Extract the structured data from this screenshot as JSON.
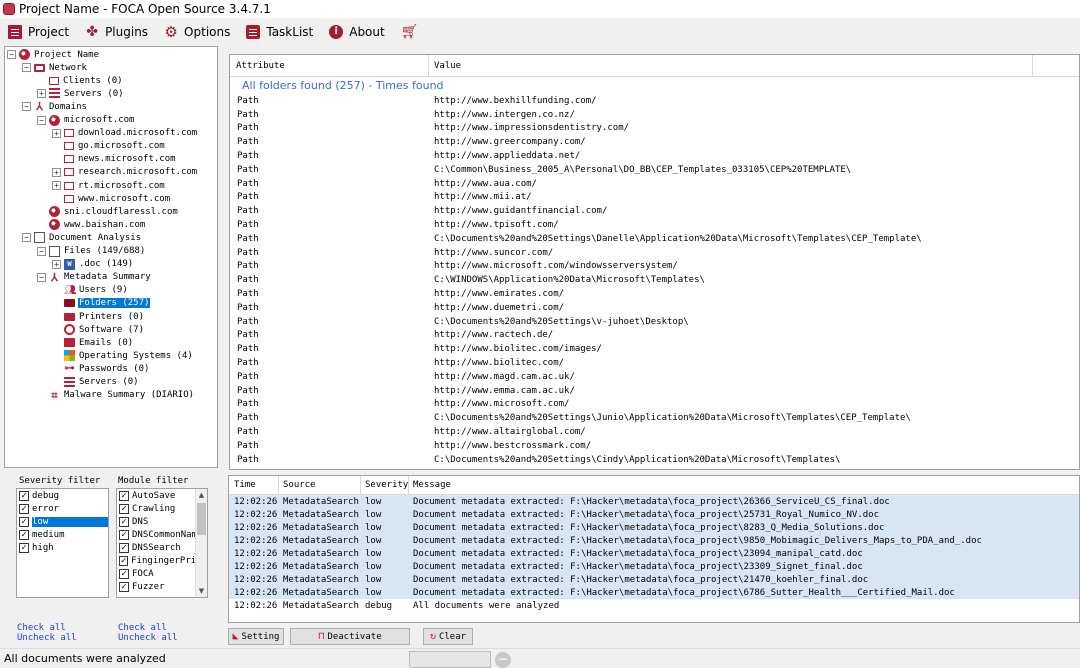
{
  "window": {
    "title": "Project Name - FOCA Open Source 3.4.7.1"
  },
  "menu": [
    {
      "label": "Project",
      "icon": "project-icon"
    },
    {
      "label": "Plugins",
      "icon": "puzzle-icon"
    },
    {
      "label": "Options",
      "icon": "gear-icon"
    },
    {
      "label": "TaskList",
      "icon": "tasklist-icon"
    },
    {
      "label": "About",
      "icon": "info-icon"
    },
    {
      "label": "",
      "icon": "cart-icon"
    }
  ],
  "tree": [
    {
      "label": "Project Name",
      "level": 0,
      "exp": "-",
      "icon": "globe"
    },
    {
      "label": "Network",
      "level": 1,
      "exp": "-",
      "icon": "monitor"
    },
    {
      "label": "Clients (0)",
      "level": 2,
      "exp": "",
      "icon": "monitor-s"
    },
    {
      "label": "Servers (0)",
      "level": 2,
      "exp": "+",
      "icon": "server"
    },
    {
      "label": "Domains",
      "level": 1,
      "exp": "-",
      "icon": "domains"
    },
    {
      "label": "microsoft.com",
      "level": 2,
      "exp": "-",
      "icon": "globe"
    },
    {
      "label": "download.microsoft.com",
      "level": 3,
      "exp": "+",
      "icon": "monitor-s"
    },
    {
      "label": "go.microsoft.com",
      "level": 3,
      "exp": "",
      "icon": "monitor-s"
    },
    {
      "label": "news.microsoft.com",
      "level": 3,
      "exp": "",
      "icon": "monitor-s"
    },
    {
      "label": "research.microsoft.com",
      "level": 3,
      "exp": "+",
      "icon": "monitor-s"
    },
    {
      "label": "rt.microsoft.com",
      "level": 3,
      "exp": "+",
      "icon": "monitor-s"
    },
    {
      "label": "www.microsoft.com",
      "level": 3,
      "exp": "",
      "icon": "monitor-s"
    },
    {
      "label": "sni.cloudflaressl.com",
      "level": 2,
      "exp": "",
      "icon": "globe"
    },
    {
      "label": "www.baishan.com",
      "level": 2,
      "exp": "",
      "icon": "globe"
    },
    {
      "label": "Document Analysis",
      "level": 1,
      "exp": "-",
      "icon": "doc"
    },
    {
      "label": "Files (149/688)",
      "level": 2,
      "exp": "-",
      "icon": "doc"
    },
    {
      "label": ".doc (149)",
      "level": 3,
      "exp": "+",
      "icon": "word"
    },
    {
      "label": "Metadata Summary",
      "level": 2,
      "exp": "-",
      "icon": "meta"
    },
    {
      "label": "Users (9)",
      "level": 3,
      "exp": "",
      "icon": "users"
    },
    {
      "label": "Folders (257)",
      "level": 3,
      "exp": "",
      "icon": "folder",
      "selected": true
    },
    {
      "label": "Printers (0)",
      "level": 3,
      "exp": "",
      "icon": "printer"
    },
    {
      "label": "Software (7)",
      "level": 3,
      "exp": "",
      "icon": "software"
    },
    {
      "label": "Emails (0)",
      "level": 3,
      "exp": "",
      "icon": "email"
    },
    {
      "label": "Operating Systems (4)",
      "level": 3,
      "exp": "",
      "icon": "os"
    },
    {
      "label": "Passwords (0)",
      "level": 3,
      "exp": "",
      "icon": "key"
    },
    {
      "label": "Servers (0)",
      "level": 3,
      "exp": "",
      "icon": "server"
    },
    {
      "label": "Malware Summary (DIARIO)",
      "level": 2,
      "exp": "",
      "icon": "malware"
    }
  ],
  "attributes": {
    "col_attribute": "Attribute",
    "col_value": "Value",
    "group_title": "All folders found (257) - Times found",
    "rows": [
      {
        "attr": "Path",
        "value": "http://www.bexhillfunding.com/"
      },
      {
        "attr": "Path",
        "value": "http://www.intergen.co.nz/"
      },
      {
        "attr": "Path",
        "value": "http://www.impressionsdentistry.com/"
      },
      {
        "attr": "Path",
        "value": "http://www.greercompany.com/"
      },
      {
        "attr": "Path",
        "value": "http://www.applieddata.net/"
      },
      {
        "attr": "Path",
        "value": "C:\\Common\\Business_2005_A\\Personal\\DO_BB\\CEP_Templates_033105\\CEP%20TEMPLATE\\"
      },
      {
        "attr": "Path",
        "value": "http://www.aua.com/"
      },
      {
        "attr": "Path",
        "value": "http://www.mii.at/"
      },
      {
        "attr": "Path",
        "value": "http://www.guidantfinancial.com/"
      },
      {
        "attr": "Path",
        "value": "http://www.tpisoft.com/"
      },
      {
        "attr": "Path",
        "value": "C:\\Documents%20and%20Settings\\Danelle\\Application%20Data\\Microsoft\\Templates\\CEP_Template\\"
      },
      {
        "attr": "Path",
        "value": "http://www.suncor.com/"
      },
      {
        "attr": "Path",
        "value": "http://www.microsoft.com/windowsserversystem/"
      },
      {
        "attr": "Path",
        "value": "C:\\WINDOWS\\Application%20Data\\Microsoft\\Templates\\"
      },
      {
        "attr": "Path",
        "value": "http://www.emirates.com/"
      },
      {
        "attr": "Path",
        "value": "http://www.duemetri.com/"
      },
      {
        "attr": "Path",
        "value": "C:\\Documents%20and%20Settings\\v-juhoet\\Desktop\\"
      },
      {
        "attr": "Path",
        "value": "http://www.ractech.de/"
      },
      {
        "attr": "Path",
        "value": "http://www.biolitec.com/images/"
      },
      {
        "attr": "Path",
        "value": "http://www.biolitec.com/"
      },
      {
        "attr": "Path",
        "value": "http://www.magd.cam.ac.uk/"
      },
      {
        "attr": "Path",
        "value": "http://www.emma.cam.ac.uk/"
      },
      {
        "attr": "Path",
        "value": "http://www.microsoft.com/"
      },
      {
        "attr": "Path",
        "value": "C:\\Documents%20and%20Settings\\Junio\\Application%20Data\\Microsoft\\Templates\\CEP_Template\\"
      },
      {
        "attr": "Path",
        "value": "http://www.altairglobal.com/"
      },
      {
        "attr": "Path",
        "value": "http://www.bestcrossmark.com/"
      },
      {
        "attr": "Path",
        "value": "C:\\Documents%20and%20Settings\\Cindy\\Application%20Data\\Microsoft\\Templates\\"
      }
    ]
  },
  "severity_filter": {
    "title": "Severity filter",
    "items": [
      {
        "label": "debug",
        "checked": true,
        "selected": false
      },
      {
        "label": "error",
        "checked": true,
        "selected": false
      },
      {
        "label": "low",
        "checked": true,
        "selected": true
      },
      {
        "label": "medium",
        "checked": true,
        "selected": false
      },
      {
        "label": "high",
        "checked": true,
        "selected": false
      }
    ],
    "check_all": "Check all",
    "uncheck_all": "Uncheck all"
  },
  "module_filter": {
    "title": "Module filter",
    "items": [
      {
        "label": "AutoSave",
        "checked": true
      },
      {
        "label": "Crawling",
        "checked": true
      },
      {
        "label": "DNS",
        "checked": true
      },
      {
        "label": "DNSCommonName",
        "checked": true
      },
      {
        "label": "DNSSearch",
        "checked": true
      },
      {
        "label": "FingingerPrint",
        "checked": true
      },
      {
        "label": "FOCA",
        "checked": true
      },
      {
        "label": "Fuzzer",
        "checked": true
      }
    ],
    "check_all": "Check all",
    "uncheck_all": "Uncheck all"
  },
  "log": {
    "col_time": "Time",
    "col_source": "Source",
    "col_severity": "Severity",
    "col_message": "Message",
    "rows": [
      {
        "time": "12:02:26",
        "source": "MetadataSearch",
        "severity": "low",
        "message": "Document metadata extracted: F:\\Hacker\\metadata\\foca_project\\26366_ServiceU_CS_final.doc"
      },
      {
        "time": "12:02:26",
        "source": "MetadataSearch",
        "severity": "low",
        "message": "Document metadata extracted: F:\\Hacker\\metadata\\foca_project\\25731_Royal_Numico_NV.doc"
      },
      {
        "time": "12:02:26",
        "source": "MetadataSearch",
        "severity": "low",
        "message": "Document metadata extracted: F:\\Hacker\\metadata\\foca_project\\8283_Q_Media_Solutions.doc"
      },
      {
        "time": "12:02:26",
        "source": "MetadataSearch",
        "severity": "low",
        "message": "Document metadata extracted: F:\\Hacker\\metadata\\foca_project\\9850_Mobimagic_Delivers_Maps_to_PDA_and_.doc"
      },
      {
        "time": "12:02:26",
        "source": "MetadataSearch",
        "severity": "low",
        "message": "Document metadata extracted: F:\\Hacker\\metadata\\foca_project\\23094_manipal_catd.doc"
      },
      {
        "time": "12:02:26",
        "source": "MetadataSearch",
        "severity": "low",
        "message": "Document metadata extracted: F:\\Hacker\\metadata\\foca_project\\23309_Signet_final.doc"
      },
      {
        "time": "12:02:26",
        "source": "MetadataSearch",
        "severity": "low",
        "message": "Document metadata extracted: F:\\Hacker\\metadata\\foca_project\\21470_koehler_final.doc"
      },
      {
        "time": "12:02:26",
        "source": "MetadataSearch",
        "severity": "low",
        "message": "Document metadata extracted: F:\\Hacker\\metadata\\foca_project\\6786_Sutter_Health___Certified_Mail.doc"
      },
      {
        "time": "12:02:26",
        "source": "MetadataSearch",
        "severity": "debug",
        "message": "All documents were analyzed"
      }
    ]
  },
  "buttons": {
    "setting": "Setting",
    "deactivate": "Deactivate",
    "clear": "Clear"
  },
  "status": {
    "text": "All documents were analyzed"
  }
}
